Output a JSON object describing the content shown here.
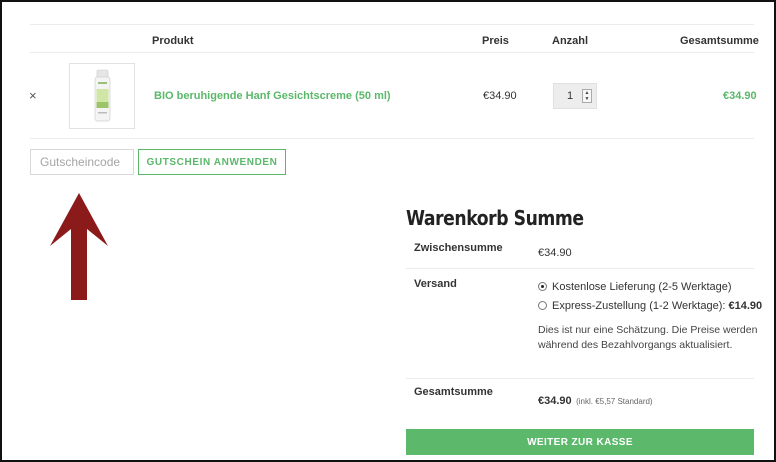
{
  "cart_table": {
    "headers": {
      "product": "Produkt",
      "price": "Preis",
      "quantity": "Anzahl",
      "subtotal": "Gesamtsumme"
    },
    "remove_symbol": "×",
    "items": [
      {
        "name": "BIO beruhigende Hanf Gesichtscreme (50 ml)",
        "price": "€34.90",
        "quantity": "1",
        "subtotal": "€34.90"
      }
    ]
  },
  "coupon": {
    "placeholder": "Gutscheincode",
    "button_label": "GUTSCHEIN ANWENDEN"
  },
  "annotation": {
    "arrow_color": "#8b1a1a"
  },
  "totals": {
    "title": "Warenkorb Summe",
    "subtotal_label": "Zwischensumme",
    "subtotal_value": "€34.90",
    "shipping_label": "Versand",
    "shipping_options": [
      {
        "label": "Kostenlose Lieferung (2-5 Werktage)",
        "price": "",
        "selected": true
      },
      {
        "label": "Express-Zustellung (1-2 Werktage):",
        "price": "€14.90",
        "selected": false
      }
    ],
    "shipping_note": "Dies ist nur eine Schätzung. Die Preise werden während des Bezahlvorgangs aktualisiert.",
    "total_label": "Gesamtsumme",
    "total_value": "€34.90",
    "tax_note": "(inkl. €5,57 Standard)",
    "checkout_label": "WEITER ZUR KASSE"
  },
  "colors": {
    "accent": "#5bb86a",
    "arrow": "#8b1a1a"
  }
}
